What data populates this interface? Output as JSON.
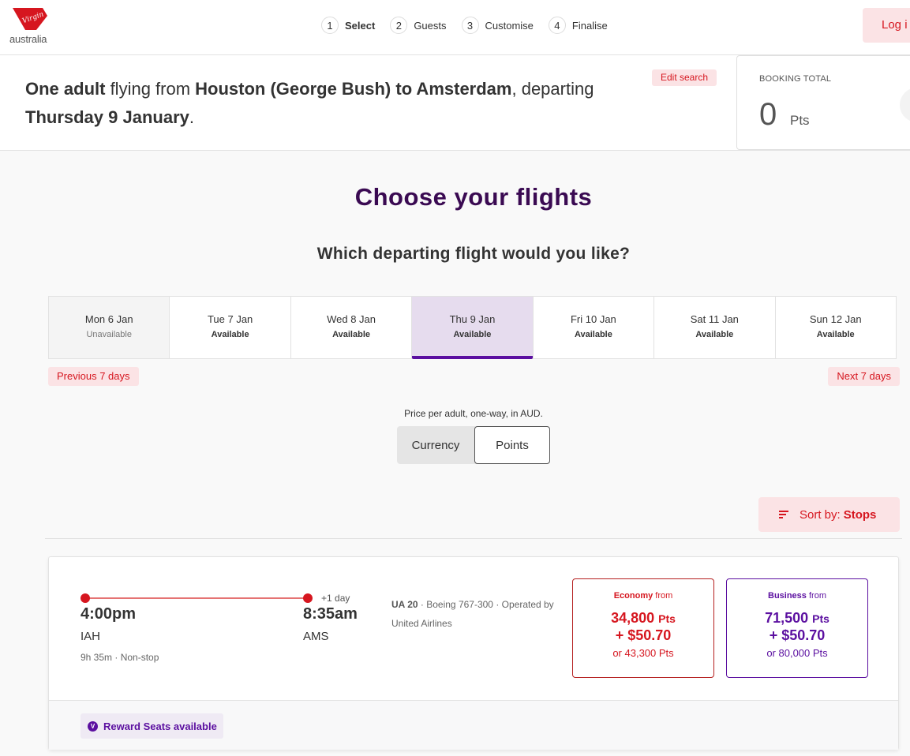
{
  "header": {
    "logo_text": "australia",
    "steps": [
      {
        "num": "1",
        "label": "Select"
      },
      {
        "num": "2",
        "label": "Guests"
      },
      {
        "num": "3",
        "label": "Customise"
      },
      {
        "num": "4",
        "label": "Finalise"
      }
    ],
    "active_step": 1,
    "login_label": "Log i",
    "brand_color": "#d6161f"
  },
  "summary": {
    "parts": {
      "passengers": "One adult",
      "flying_from": " flying from ",
      "route": "Houston (George Bush) to Amsterdam",
      "departing": ", departing ",
      "date": "Thursday 9 January",
      "end": "."
    },
    "edit_search_label": "Edit search",
    "booking_total": {
      "label": "BOOKING TOTAL",
      "value": "0",
      "unit": "Pts"
    }
  },
  "main": {
    "title": "Choose your flights",
    "subtitle": "Which departing flight would you like?",
    "dates": [
      {
        "label": "Mon 6 Jan",
        "status": "Unavailable",
        "state": "unavailable"
      },
      {
        "label": "Tue 7 Jan",
        "status": "Available",
        "state": "available"
      },
      {
        "label": "Wed 8 Jan",
        "status": "Available",
        "state": "available"
      },
      {
        "label": "Thu 9 Jan",
        "status": "Available",
        "state": "selected"
      },
      {
        "label": "Fri 10 Jan",
        "status": "Available",
        "state": "available"
      },
      {
        "label": "Sat 11 Jan",
        "status": "Available",
        "state": "available"
      },
      {
        "label": "Sun 12 Jan",
        "status": "Available",
        "state": "available"
      }
    ],
    "prev_label": "Previous 7 days",
    "next_label": "Next 7 days",
    "price_note": "Price per adult, one-way, in AUD.",
    "toggle": {
      "options": [
        "Currency",
        "Points"
      ],
      "selected": "Points"
    },
    "sort": {
      "prefix": "Sort by:",
      "value": "Stops"
    }
  },
  "flights": [
    {
      "departure_time": "4:00pm",
      "departure_code": "IAH",
      "arrival_time": "8:35am",
      "arrival_code": "AMS",
      "day_offset": "+1 day",
      "duration": "9h 35m ·  Non-stop",
      "flight_number": "UA 20",
      "details": " · Boeing 767-300 · Operated by United Airlines",
      "fares": {
        "economy": {
          "cabin": "Economy",
          "from": "from",
          "points": "34,800",
          "unit": "Pts",
          "cash": "+ $50.70",
          "alt": "or 43,300 Pts",
          "color": "#d6161f"
        },
        "business": {
          "cabin": "Business",
          "from": "from",
          "points": "71,500",
          "unit": "Pts",
          "cash": "+ $50.70",
          "alt": "or 80,000 Pts",
          "color": "#5b0fa0"
        }
      },
      "badge": {
        "icon_letter": "V",
        "label": "Reward Seats available"
      }
    }
  ]
}
